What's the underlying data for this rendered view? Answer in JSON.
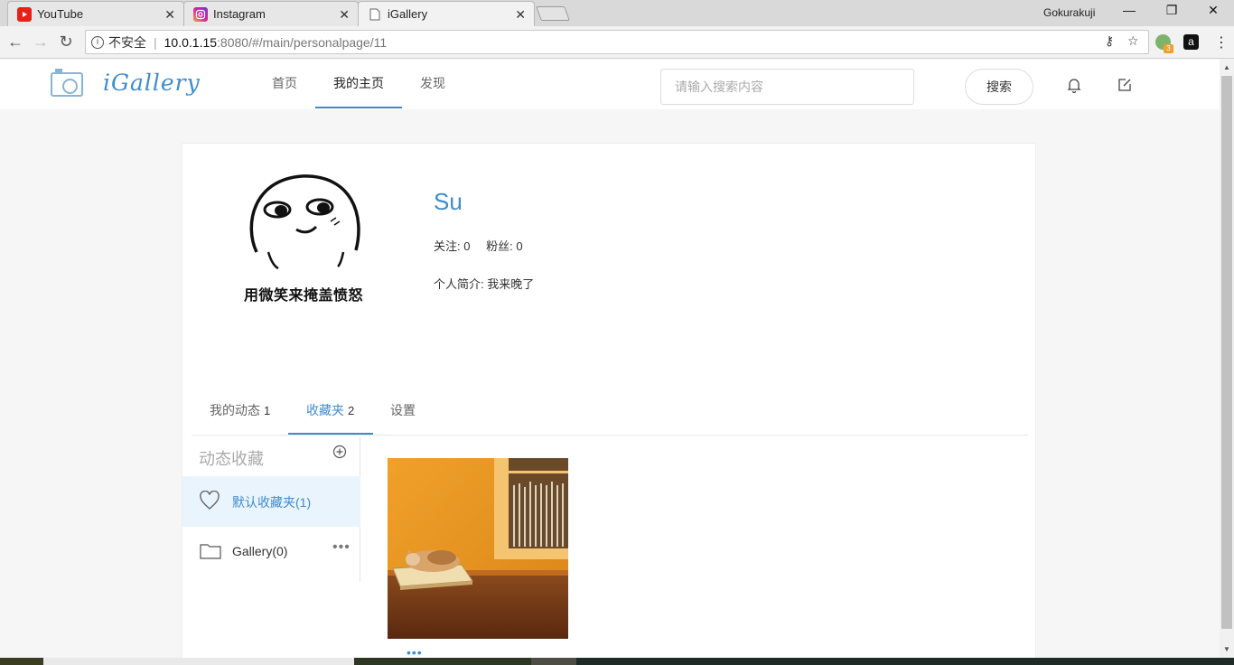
{
  "browser": {
    "tabs": [
      {
        "title": "YouTube",
        "icon": "youtube-icon",
        "active": false
      },
      {
        "title": "Instagram",
        "icon": "instagram-icon",
        "active": false
      },
      {
        "title": "iGallery",
        "icon": "page-icon",
        "active": true
      }
    ],
    "profile_name": "Gokurakuji",
    "address": {
      "security_label": "不安全",
      "host": "10.0.1.15",
      "path": ":8080/#/main/personalpage/11"
    },
    "extension_badge": "3"
  },
  "header": {
    "logo_text": "iGallery",
    "nav": [
      "首页",
      "我的主页",
      "发现"
    ],
    "active_nav": "我的主页",
    "search_placeholder": "请输入搜索内容",
    "search_button": "搜索"
  },
  "profile": {
    "avatar_caption": "用微笑来掩盖愤怒",
    "name": "Su",
    "following_label": "关注: 0",
    "followers_label": "粉丝: 0",
    "bio_label": "个人简介:",
    "bio": "我来晚了"
  },
  "profile_tabs": [
    {
      "label": "我的动态",
      "count": "1"
    },
    {
      "label": "收藏夹",
      "count": "2"
    },
    {
      "label": "设置",
      "count": ""
    }
  ],
  "collections": {
    "title": "动态收藏",
    "items": [
      {
        "label": "默认收藏夹(1)",
        "icon": "heart-icon"
      },
      {
        "label": "Gallery(0)",
        "icon": "folder-icon"
      }
    ],
    "more": "•••"
  },
  "colors": {
    "accent": "#3d8cd0",
    "selected_bg": "#eaf4fd"
  }
}
